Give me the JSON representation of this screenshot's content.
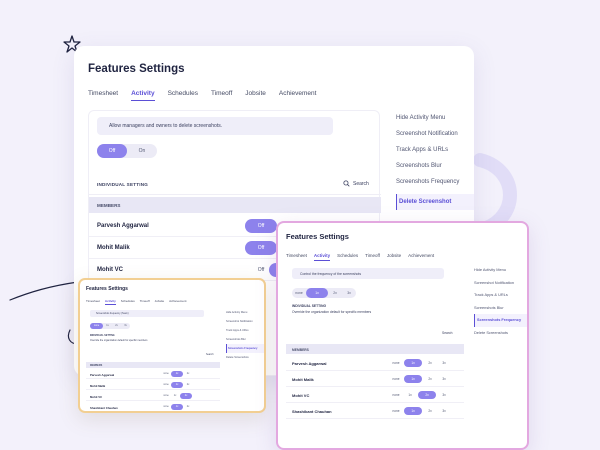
{
  "colors": {
    "accent": "#8d82ec",
    "accent_text": "#5b4fd6",
    "background": "#f3f1fb",
    "second_card_border": "#e3a8e0",
    "third_card_border": "#f2cf92"
  },
  "icons": [
    "star-icon",
    "search-icon"
  ],
  "main_card": {
    "title": "Features Settings",
    "tabs": [
      "Timesheet",
      "Activity",
      "Schedules",
      "Timeoff",
      "Jobsite",
      "Achievement"
    ],
    "notice": "Allow managers and owners to delete screenshots.",
    "toggle": {
      "off": "Off",
      "on": "On"
    },
    "individual_setting": "INDIVIDUAL SETTING",
    "search_label": "Search",
    "members_header": "MEMBERS",
    "members": [
      {
        "name": "Parvesh Aggarwal",
        "state": "Off"
      },
      {
        "name": "Mohit Malik",
        "state": "Off"
      },
      {
        "name": "Mohit VC",
        "state": "Off"
      }
    ],
    "sidebar": [
      "Hide Activity Menu",
      "Screenshot Notification",
      "Track Apps & URLs",
      "Screenshots Blur",
      "Screenshots Frequency",
      "Delete Screenshot"
    ]
  },
  "second_card": {
    "title": "Features Settings",
    "tabs": [
      "Timesheet",
      "Activity",
      "Schedules",
      "Timeoff",
      "Jobsite",
      "Achievement"
    ],
    "notice": "Control the frequency of the screenshots",
    "freq_options": [
      "none",
      "1x",
      "2x",
      "3x"
    ],
    "individual_setting": "INDIVIDUAL SETTING",
    "individual_desc": "Override the organization default for specific members",
    "search_label": "Search",
    "members_header": "MEMBERS",
    "members": [
      {
        "name": "Parvesh Aggarwal",
        "options": [
          "none",
          "1x",
          "2x",
          "3x"
        ]
      },
      {
        "name": "Mohit Malik",
        "options": [
          "none",
          "1x",
          "2x",
          "3x"
        ]
      },
      {
        "name": "Mohit VC",
        "options": [
          "none",
          "1x",
          "2x",
          "3x"
        ]
      },
      {
        "name": "Shashikant Chauhan",
        "options": [
          "none",
          "1x",
          "2x",
          "3x"
        ]
      }
    ],
    "sidebar": [
      "Hide Activity Menu",
      "Screenshot Notification",
      "Track Apps & URLs",
      "Screenshots Blur",
      "Screenshots Frequency",
      "Delete Screenshots"
    ]
  },
  "third_card": {
    "title": "Features Settings",
    "tabs": [
      "Timesheet",
      "Activity",
      "Schedules",
      "Timeoff",
      "Jobsite",
      "Achievement"
    ],
    "notice": "Screenshots frequency (Team)",
    "freq_options": [
      "none",
      "1x",
      "2x",
      "3x"
    ],
    "individual_setting": "INDIVIDUAL SETTING",
    "individual_desc": "Override the organization default for specific members",
    "search_label": "Search",
    "members_header": "MEMBERS",
    "members": [
      {
        "name": "Parvesh Aggarwal",
        "options": [
          "none",
          "1x",
          "2x",
          "3x"
        ]
      },
      {
        "name": "Mohit Malik",
        "options": [
          "none",
          "1x",
          "2x",
          "3x"
        ]
      },
      {
        "name": "Mohit VC",
        "options": [
          "none",
          "1x",
          "2x",
          "3x"
        ]
      },
      {
        "name": "Shashikant Chauhan",
        "options": [
          "none",
          "1x",
          "2x",
          "3x"
        ]
      }
    ],
    "sidebar": [
      "Hide Activity Menu",
      "Screenshot Notification",
      "Track Apps & URLs",
      "Screenshots Blur",
      "Screenshots Frequency",
      "Delete Screenshots"
    ]
  }
}
